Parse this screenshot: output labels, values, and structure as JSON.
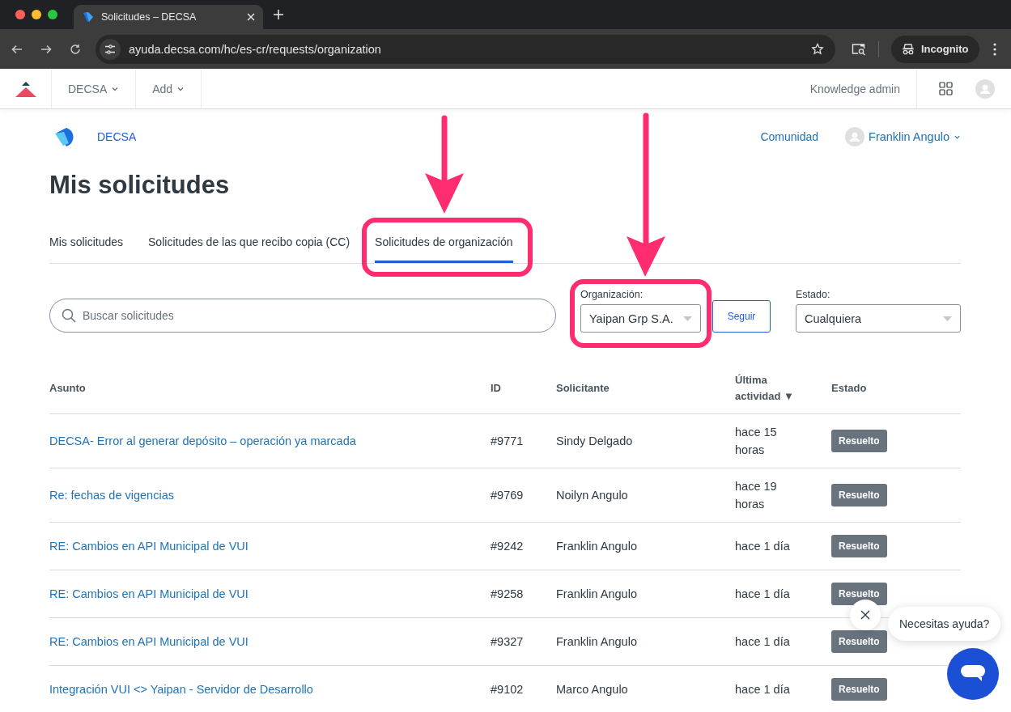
{
  "browser": {
    "tab_title": "Solicitudes – DECSA",
    "url": "ayuda.decsa.com/hc/es-cr/requests/organization",
    "profile": "Incognito"
  },
  "topnav": {
    "items": [
      {
        "label": "DECSA"
      },
      {
        "label": "Add"
      }
    ],
    "admin_link": "Knowledge admin"
  },
  "header": {
    "brand": "DECSA",
    "links": [
      "Comunidad"
    ],
    "user": "Franklin Angulo"
  },
  "title": "Mis solicitudes",
  "tabs": [
    {
      "label": "Mis solicitudes",
      "selected": false
    },
    {
      "label": "Solicitudes de las que recibo copia (CC)",
      "selected": false
    },
    {
      "label": "Solicitudes de organización",
      "selected": true
    }
  ],
  "search": {
    "placeholder": "Buscar solicitudes"
  },
  "filters": {
    "organization": {
      "label": "Organización:",
      "value": "Yaipan Grp S.A."
    },
    "follow_button": "Seguir",
    "status": {
      "label": "Estado:",
      "value": "Cualquiera"
    }
  },
  "table": {
    "columns": [
      {
        "label": "Asunto",
        "sorted": false
      },
      {
        "label": "ID",
        "sorted": false
      },
      {
        "label": "Solicitante",
        "sorted": false
      },
      {
        "label": "Última actividad",
        "sorted": true,
        "sort_mark": "▼"
      },
      {
        "label": "Estado",
        "sorted": false
      }
    ],
    "rows": [
      {
        "subject": "DECSA- Error al generar depósito – operación ya marcada",
        "id": "#9771",
        "requester": "Sindy Delgado",
        "activity": "hace 15 horas",
        "status": "Resuelto"
      },
      {
        "subject": "Re: fechas de vigencias",
        "id": "#9769",
        "requester": "Noilyn Angulo",
        "activity": "hace 19 horas",
        "status": "Resuelto"
      },
      {
        "subject": "RE: Cambios en API Municipal de VUI",
        "id": "#9242",
        "requester": "Franklin Angulo",
        "activity": "hace 1 día",
        "status": "Resuelto"
      },
      {
        "subject": "RE: Cambios en API Municipal de VUI",
        "id": "#9258",
        "requester": "Franklin Angulo",
        "activity": "hace 1 día",
        "status": "Resuelto"
      },
      {
        "subject": "RE: Cambios en API Municipal de VUI",
        "id": "#9327",
        "requester": "Franklin Angulo",
        "activity": "hace 1 día",
        "status": "Resuelto"
      },
      {
        "subject": "Integración VUI <> Yaipan - Servidor de Desarrollo",
        "id": "#9102",
        "requester": "Marco Angulo",
        "activity": "hace 1 día",
        "status": "Resuelto"
      }
    ]
  },
  "chat": {
    "prompt": "Necesitas ayuda?"
  }
}
